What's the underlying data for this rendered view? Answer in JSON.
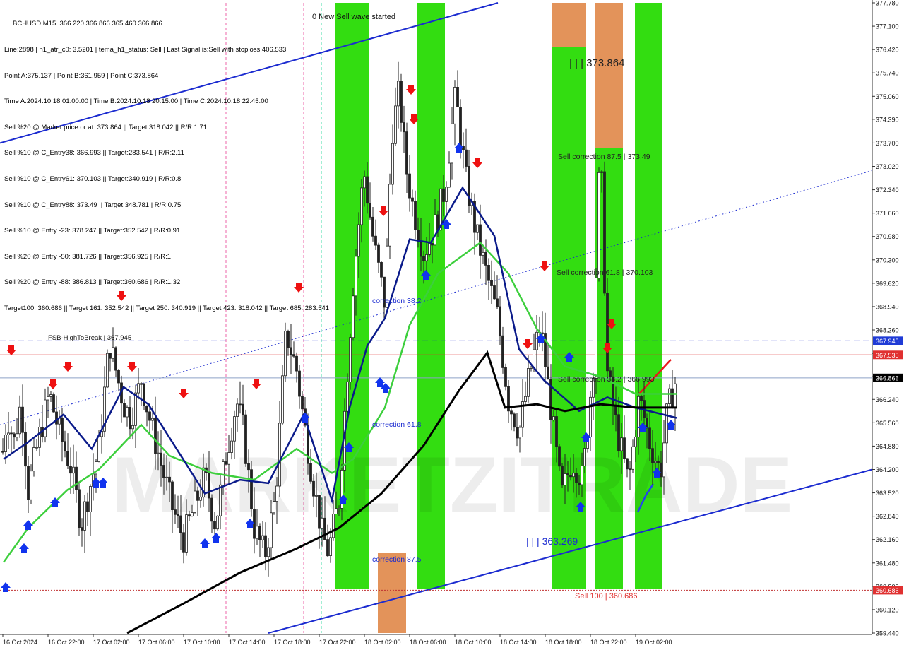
{
  "window": {
    "symbol_line": "BCHUSD,M15  366.220 366.866 365.460 366.866"
  },
  "info_lines": [
    "Line:2898 | h1_atr_c0: 3.5201 | tema_h1_status: Sell | Last Signal is:Sell with stoploss:406.533",
    "Point A:375.137 | Point B:361.959 | Point C:373.864",
    "Time A:2024.10.18 01:00:00 | Time B:2024.10.18 20:15:00 | Time C:2024.10.18 22:45:00",
    "Sell %20 @ Market price or at: 373.864 || Target:318.042 || R/R:1.71",
    "Sell %10 @ C_Entry38: 366.993 || Target:283.541 | R/R:2.11",
    "Sell %10 @ C_Entry61: 370.103 || Target:340.919 | R/R:0.8",
    "Sell %10 @ C_Entry88: 373.49 || Target:348.781 | R/R:0.75",
    "Sell %10 @ Entry -23: 378.247 || Target:352.542 | R/R:0.91",
    "Sell %20 @ Entry -50: 381.726 || Target:356.925 | R/R:1",
    "Sell %20 @ Entry -88: 386.813 || Target:360.686 | R/R:1.32",
    "Target100: 360.686 || Target 161: 352.542 || Target 250: 340.919 || Target 423: 318.042 || Target 685: 283.541"
  ],
  "annotations": {
    "wave": "0 New Sell wave started",
    "point_c": "| | | 373.864",
    "point_b": "| | | 363.269",
    "sell_corr_875": "Sell correction 87.5 | 373.49",
    "sell_corr_618": "Sell correction 61.8 | 370.103",
    "sell_corr_382": "Sell correction 38.2 | 366.993",
    "corr_382": "correction 38.2",
    "corr_618": "correction 61.8",
    "corr_875": "correction 87.5",
    "sell_100": "Sell 100 | 360.686",
    "fsb": "FSB-HighToBreak | 367.945",
    "watermark": "MARKETZITRADE"
  },
  "price_axis": {
    "ticks": [
      "377.780",
      "377.100",
      "376.420",
      "375.740",
      "375.060",
      "374.390",
      "373.700",
      "373.020",
      "372.340",
      "371.660",
      "370.980",
      "370.300",
      "369.620",
      "368.940",
      "368.260",
      "367.580",
      "366.900",
      "366.240",
      "365.560",
      "364.880",
      "364.200",
      "363.520",
      "362.840",
      "362.160",
      "361.480",
      "360.800",
      "360.120",
      "359.440"
    ],
    "min": 359.44,
    "max": 377.78
  },
  "price_tags": [
    {
      "text": "367.945",
      "value": 367.945,
      "color": "#1f3bd6"
    },
    {
      "text": "367.535",
      "value": 367.535,
      "color": "#e03030"
    },
    {
      "text": "366.866",
      "value": 366.866,
      "color": "#000000"
    },
    {
      "text": "360.686",
      "value": 360.686,
      "color": "#e03030"
    }
  ],
  "time_axis": [
    "16 Oct 2024",
    "16 Oct 22:00",
    "17 Oct 02:00",
    "17 Oct 06:00",
    "17 Oct 10:00",
    "17 Oct 14:00",
    "17 Oct 18:00",
    "17 Oct 22:00",
    "18 Oct 02:00",
    "18 Oct 06:00",
    "18 Oct 10:00",
    "18 Oct 14:00",
    "18 Oct 18:00",
    "18 Oct 22:00",
    "19 Oct 02:00"
  ],
  "colors": {
    "green_zone": "#33dd11",
    "orange_zone": "#e3935a",
    "bull_candle": "#222222",
    "black_ma": "#000000",
    "navy_ma": "#0a1a8a",
    "green_ma": "#3dcf3d",
    "channel": "#1b2bd0",
    "sell_arrow": "#ee1111",
    "buy_arrow": "#1133ee"
  },
  "chart_data": {
    "type": "candlestick",
    "symbol": "BCHUSD",
    "timeframe": "M15",
    "last": {
      "open": 366.22,
      "high": 366.866,
      "low": 365.46,
      "close": 366.866
    },
    "levels": [
      {
        "name": "FSB-HighToBreak",
        "value": 367.945
      },
      {
        "value": 367.535
      },
      {
        "value": 366.866
      },
      {
        "name": "Sell 100",
        "value": 360.686
      }
    ],
    "price_path": [
      [
        0,
        364.0
      ],
      [
        10,
        365.8
      ],
      [
        20,
        365.0
      ],
      [
        30,
        366.2
      ],
      [
        40,
        363.6
      ],
      [
        55,
        365.1
      ],
      [
        70,
        366.4
      ],
      [
        85,
        365.2
      ],
      [
        100,
        364.3
      ],
      [
        115,
        362.6
      ],
      [
        125,
        363.5
      ],
      [
        140,
        364.8
      ],
      [
        155,
        367.9
      ],
      [
        165,
        367.0
      ],
      [
        175,
        366.1
      ],
      [
        185,
        365.7
      ],
      [
        200,
        366.8
      ],
      [
        215,
        365.4
      ],
      [
        230,
        364.2
      ],
      [
        245,
        363.0
      ],
      [
        260,
        362.2
      ],
      [
        275,
        363.1
      ],
      [
        290,
        364.0
      ],
      [
        305,
        362.6
      ],
      [
        320,
        364.6
      ],
      [
        335,
        366.2
      ],
      [
        345,
        365.3
      ],
      [
        360,
        362.5
      ],
      [
        375,
        361.7
      ],
      [
        390,
        363.4
      ],
      [
        405,
        368.2
      ],
      [
        420,
        367.1
      ],
      [
        430,
        365.6
      ],
      [
        440,
        364.3
      ],
      [
        455,
        362.4
      ],
      [
        465,
        361.8
      ],
      [
        480,
        363.3
      ],
      [
        490,
        366.5
      ],
      [
        500,
        369.6
      ],
      [
        515,
        372.9
      ],
      [
        530,
        370.7
      ],
      [
        545,
        369.0
      ],
      [
        555,
        374.0
      ],
      [
        565,
        375.2
      ],
      [
        575,
        373.0
      ],
      [
        585,
        371.8
      ],
      [
        600,
        370.5
      ],
      [
        615,
        371.2
      ],
      [
        630,
        372.4
      ],
      [
        645,
        375.1
      ],
      [
        660,
        372.6
      ],
      [
        675,
        371.0
      ],
      [
        690,
        369.8
      ],
      [
        705,
        368.6
      ],
      [
        720,
        366.2
      ],
      [
        735,
        365.3
      ],
      [
        750,
        367.0
      ],
      [
        765,
        368.4
      ],
      [
        780,
        366.0
      ],
      [
        795,
        363.4
      ],
      [
        810,
        364.5
      ],
      [
        825,
        363.9
      ],
      [
        840,
        367.3
      ],
      [
        850,
        373.8
      ],
      [
        860,
        367.0
      ],
      [
        875,
        365.2
      ],
      [
        890,
        363.8
      ],
      [
        905,
        366.3
      ],
      [
        920,
        365.0
      ],
      [
        935,
        364.1
      ],
      [
        945,
        365.9
      ],
      [
        958,
        366.87
      ]
    ],
    "ma_black": [
      [
        180,
        359.44
      ],
      [
        260,
        360.3
      ],
      [
        340,
        361.2
      ],
      [
        420,
        361.9
      ],
      [
        480,
        362.5
      ],
      [
        540,
        363.5
      ],
      [
        600,
        364.9
      ],
      [
        650,
        366.5
      ],
      [
        690,
        367.6
      ],
      [
        715,
        366.0
      ],
      [
        760,
        366.1
      ],
      [
        800,
        365.9
      ],
      [
        850,
        366.1
      ],
      [
        900,
        366.0
      ],
      [
        958,
        366.0
      ]
    ],
    "ma_navy": [
      [
        5,
        364.5
      ],
      [
        40,
        365.0
      ],
      [
        90,
        365.8
      ],
      [
        130,
        364.8
      ],
      [
        175,
        366.6
      ],
      [
        210,
        366.1
      ],
      [
        250,
        364.8
      ],
      [
        290,
        363.5
      ],
      [
        340,
        363.9
      ],
      [
        380,
        363.8
      ],
      [
        430,
        365.8
      ],
      [
        470,
        363.3
      ],
      [
        495,
        366.0
      ],
      [
        520,
        367.8
      ],
      [
        545,
        368.6
      ],
      [
        580,
        370.9
      ],
      [
        610,
        370.8
      ],
      [
        655,
        372.4
      ],
      [
        700,
        371.0
      ],
      [
        735,
        367.7
      ],
      [
        770,
        366.8
      ],
      [
        820,
        365.9
      ],
      [
        860,
        366.3
      ],
      [
        900,
        366.0
      ],
      [
        958,
        365.7
      ]
    ],
    "ma_green": [
      [
        5,
        361.5
      ],
      [
        40,
        362.5
      ],
      [
        95,
        363.6
      ],
      [
        140,
        364.2
      ],
      [
        200,
        365.5
      ],
      [
        240,
        364.6
      ],
      [
        300,
        364.1
      ],
      [
        360,
        363.9
      ],
      [
        420,
        364.8
      ],
      [
        470,
        364.1
      ],
      [
        500,
        364.5
      ],
      [
        545,
        366.0
      ],
      [
        580,
        368.4
      ],
      [
        620,
        369.9
      ],
      [
        680,
        370.8
      ],
      [
        720,
        369.9
      ],
      [
        760,
        368.3
      ],
      [
        800,
        367.2
      ],
      [
        850,
        366.9
      ],
      [
        900,
        366.4
      ],
      [
        958,
        366.4
      ]
    ],
    "channel_upper": [
      [
        0,
        373.7
      ],
      [
        705,
        377.78
      ]
    ],
    "channel_lower": [
      [
        380,
        359.44
      ],
      [
        1235,
        364.2
      ]
    ],
    "dotted_trend": [
      [
        0,
        365.5
      ],
      [
        1235,
        372.9
      ]
    ],
    "green_zones": [
      [
        474,
        522
      ],
      [
        591,
        630
      ],
      [
        782,
        830
      ],
      [
        843,
        882
      ],
      [
        899,
        938
      ]
    ],
    "orange_zones": [
      [
        535,
        575
      ],
      [
        782,
        830
      ],
      [
        843,
        882
      ]
    ]
  }
}
